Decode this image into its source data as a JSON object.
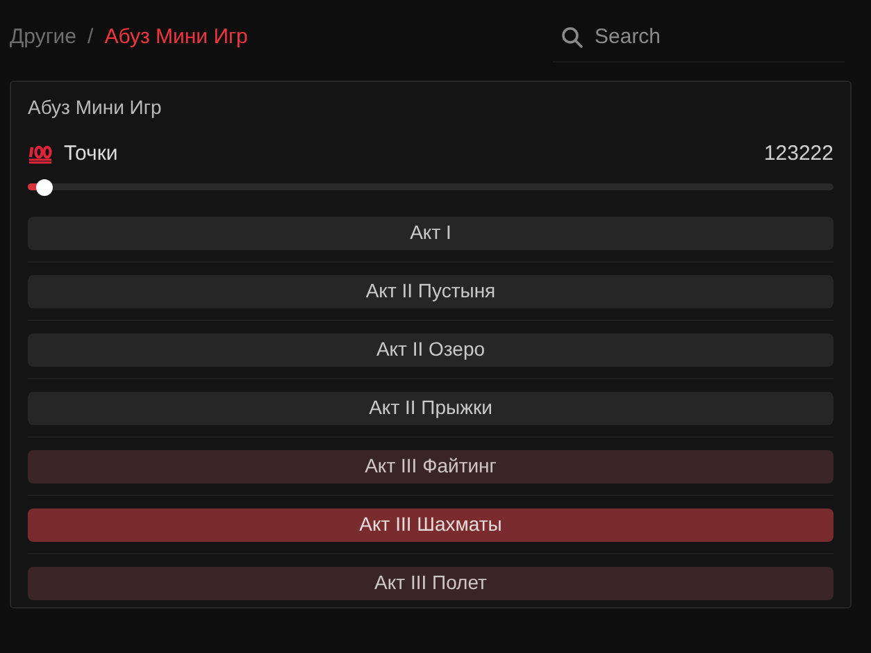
{
  "breadcrumb": [
    {
      "label": "Другие",
      "selected": false
    },
    {
      "label": "Абуз Мини Игр",
      "selected": true
    }
  ],
  "breadcrumb_separator": "/",
  "search": {
    "placeholder": "Search"
  },
  "panel": {
    "title": "Абуз Мини Игр",
    "slider": {
      "label": "Точки",
      "reading": "123222",
      "level": 0.02
    },
    "buttons": [
      {
        "label": "Акт I",
        "kind": "neutral"
      },
      {
        "label": "Акт II Пустыня",
        "kind": "neutral"
      },
      {
        "label": "Акт II Озеро",
        "kind": "neutral"
      },
      {
        "label": "Акт II Прыжки",
        "kind": "neutral"
      },
      {
        "label": "Акт III Файтинг",
        "kind": "dim"
      },
      {
        "label": "Акт III Шахматы",
        "kind": "accent"
      },
      {
        "label": "Акт III Полет",
        "kind": "dim"
      }
    ]
  }
}
